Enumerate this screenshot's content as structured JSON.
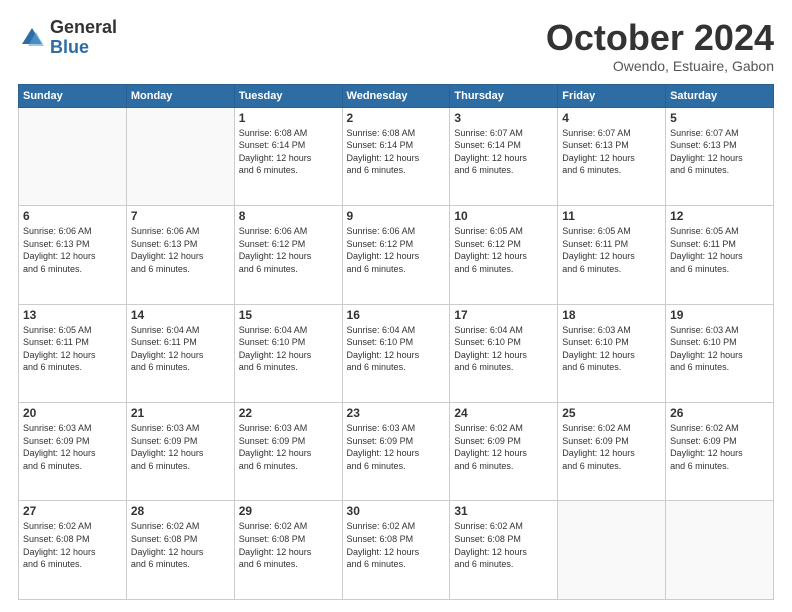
{
  "header": {
    "logo_general": "General",
    "logo_blue": "Blue",
    "month": "October 2024",
    "location": "Owendo, Estuaire, Gabon"
  },
  "days_of_week": [
    "Sunday",
    "Monday",
    "Tuesday",
    "Wednesday",
    "Thursday",
    "Friday",
    "Saturday"
  ],
  "weeks": [
    [
      {
        "day": "",
        "info": ""
      },
      {
        "day": "",
        "info": ""
      },
      {
        "day": "1",
        "info": "Sunrise: 6:08 AM\nSunset: 6:14 PM\nDaylight: 12 hours\nand 6 minutes."
      },
      {
        "day": "2",
        "info": "Sunrise: 6:08 AM\nSunset: 6:14 PM\nDaylight: 12 hours\nand 6 minutes."
      },
      {
        "day": "3",
        "info": "Sunrise: 6:07 AM\nSunset: 6:14 PM\nDaylight: 12 hours\nand 6 minutes."
      },
      {
        "day": "4",
        "info": "Sunrise: 6:07 AM\nSunset: 6:13 PM\nDaylight: 12 hours\nand 6 minutes."
      },
      {
        "day": "5",
        "info": "Sunrise: 6:07 AM\nSunset: 6:13 PM\nDaylight: 12 hours\nand 6 minutes."
      }
    ],
    [
      {
        "day": "6",
        "info": "Sunrise: 6:06 AM\nSunset: 6:13 PM\nDaylight: 12 hours\nand 6 minutes."
      },
      {
        "day": "7",
        "info": "Sunrise: 6:06 AM\nSunset: 6:13 PM\nDaylight: 12 hours\nand 6 minutes."
      },
      {
        "day": "8",
        "info": "Sunrise: 6:06 AM\nSunset: 6:12 PM\nDaylight: 12 hours\nand 6 minutes."
      },
      {
        "day": "9",
        "info": "Sunrise: 6:06 AM\nSunset: 6:12 PM\nDaylight: 12 hours\nand 6 minutes."
      },
      {
        "day": "10",
        "info": "Sunrise: 6:05 AM\nSunset: 6:12 PM\nDaylight: 12 hours\nand 6 minutes."
      },
      {
        "day": "11",
        "info": "Sunrise: 6:05 AM\nSunset: 6:11 PM\nDaylight: 12 hours\nand 6 minutes."
      },
      {
        "day": "12",
        "info": "Sunrise: 6:05 AM\nSunset: 6:11 PM\nDaylight: 12 hours\nand 6 minutes."
      }
    ],
    [
      {
        "day": "13",
        "info": "Sunrise: 6:05 AM\nSunset: 6:11 PM\nDaylight: 12 hours\nand 6 minutes."
      },
      {
        "day": "14",
        "info": "Sunrise: 6:04 AM\nSunset: 6:11 PM\nDaylight: 12 hours\nand 6 minutes."
      },
      {
        "day": "15",
        "info": "Sunrise: 6:04 AM\nSunset: 6:10 PM\nDaylight: 12 hours\nand 6 minutes."
      },
      {
        "day": "16",
        "info": "Sunrise: 6:04 AM\nSunset: 6:10 PM\nDaylight: 12 hours\nand 6 minutes."
      },
      {
        "day": "17",
        "info": "Sunrise: 6:04 AM\nSunset: 6:10 PM\nDaylight: 12 hours\nand 6 minutes."
      },
      {
        "day": "18",
        "info": "Sunrise: 6:03 AM\nSunset: 6:10 PM\nDaylight: 12 hours\nand 6 minutes."
      },
      {
        "day": "19",
        "info": "Sunrise: 6:03 AM\nSunset: 6:10 PM\nDaylight: 12 hours\nand 6 minutes."
      }
    ],
    [
      {
        "day": "20",
        "info": "Sunrise: 6:03 AM\nSunset: 6:09 PM\nDaylight: 12 hours\nand 6 minutes."
      },
      {
        "day": "21",
        "info": "Sunrise: 6:03 AM\nSunset: 6:09 PM\nDaylight: 12 hours\nand 6 minutes."
      },
      {
        "day": "22",
        "info": "Sunrise: 6:03 AM\nSunset: 6:09 PM\nDaylight: 12 hours\nand 6 minutes."
      },
      {
        "day": "23",
        "info": "Sunrise: 6:03 AM\nSunset: 6:09 PM\nDaylight: 12 hours\nand 6 minutes."
      },
      {
        "day": "24",
        "info": "Sunrise: 6:02 AM\nSunset: 6:09 PM\nDaylight: 12 hours\nand 6 minutes."
      },
      {
        "day": "25",
        "info": "Sunrise: 6:02 AM\nSunset: 6:09 PM\nDaylight: 12 hours\nand 6 minutes."
      },
      {
        "day": "26",
        "info": "Sunrise: 6:02 AM\nSunset: 6:09 PM\nDaylight: 12 hours\nand 6 minutes."
      }
    ],
    [
      {
        "day": "27",
        "info": "Sunrise: 6:02 AM\nSunset: 6:08 PM\nDaylight: 12 hours\nand 6 minutes."
      },
      {
        "day": "28",
        "info": "Sunrise: 6:02 AM\nSunset: 6:08 PM\nDaylight: 12 hours\nand 6 minutes."
      },
      {
        "day": "29",
        "info": "Sunrise: 6:02 AM\nSunset: 6:08 PM\nDaylight: 12 hours\nand 6 minutes."
      },
      {
        "day": "30",
        "info": "Sunrise: 6:02 AM\nSunset: 6:08 PM\nDaylight: 12 hours\nand 6 minutes."
      },
      {
        "day": "31",
        "info": "Sunrise: 6:02 AM\nSunset: 6:08 PM\nDaylight: 12 hours\nand 6 minutes."
      },
      {
        "day": "",
        "info": ""
      },
      {
        "day": "",
        "info": ""
      }
    ]
  ]
}
